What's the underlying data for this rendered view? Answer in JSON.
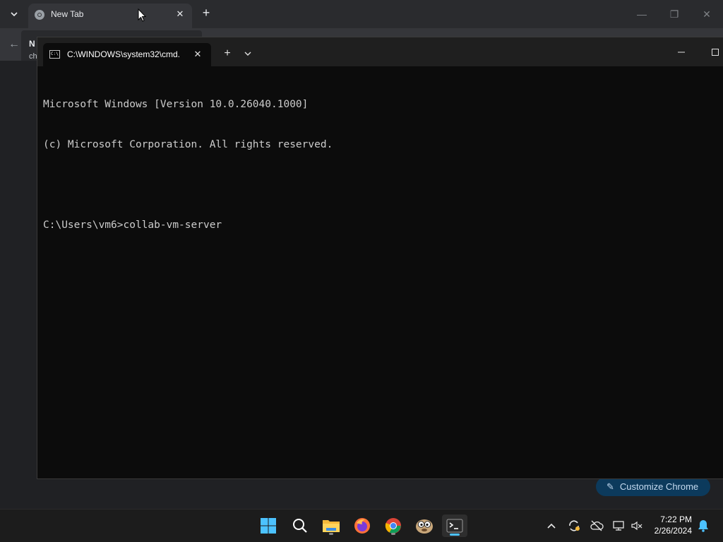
{
  "chrome": {
    "tab_title": "New Tab",
    "menu_stub_line1": "N",
    "menu_stub_line2": "ch",
    "customize_label": "Customize Chrome"
  },
  "terminal": {
    "tab_title": "C:\\WINDOWS\\system32\\cmd.",
    "lines": [
      "Microsoft Windows [Version 10.0.26040.1000]",
      "(c) Microsoft Corporation. All rights reserved.",
      "",
      "C:\\Users\\vm6>collab-vm-server"
    ]
  },
  "taskbar": {
    "apps": [
      "start-icon",
      "search-icon",
      "file-explorer-icon",
      "firefox-icon",
      "chrome-icon",
      "pidgin-icon",
      "terminal-icon"
    ],
    "clock_time": "7:22 PM",
    "clock_date": "2/26/2024"
  },
  "colors": {
    "accent": "#4cc2ff",
    "terminal_bg": "#0c0c0c",
    "terminal_text": "#cccccc",
    "taskbar_bg": "#1c1c1c"
  }
}
